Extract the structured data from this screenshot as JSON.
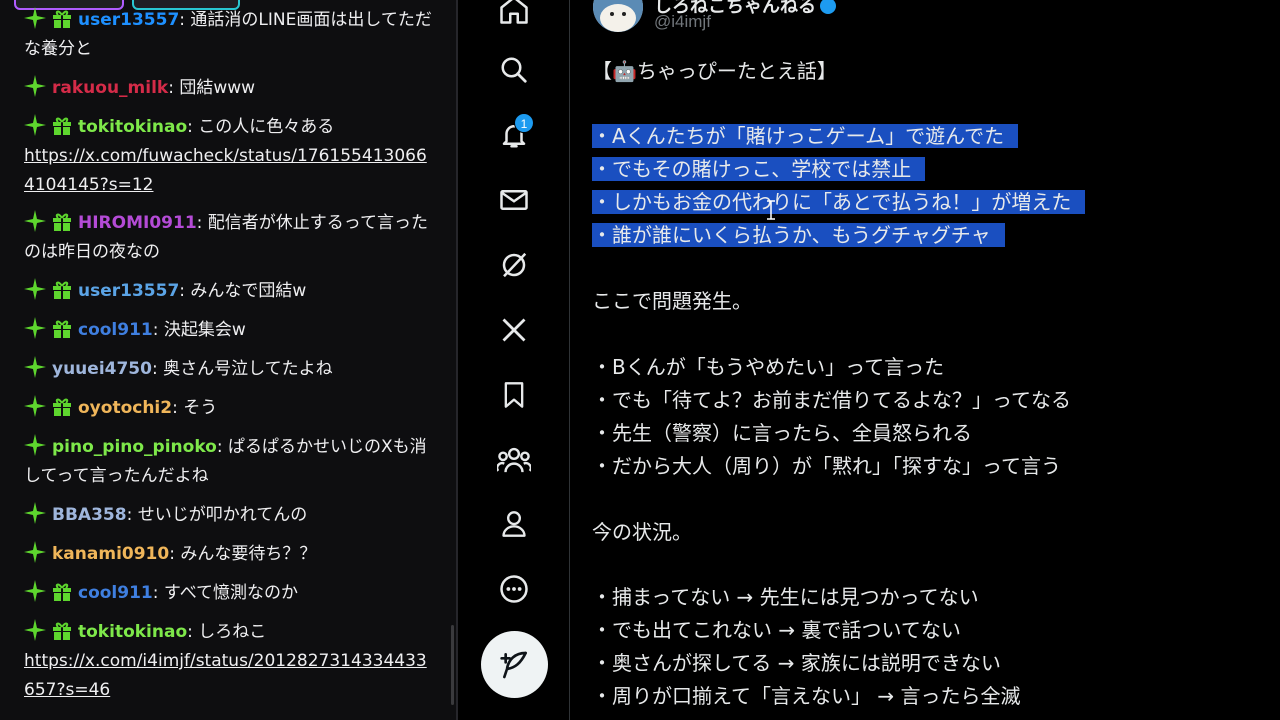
{
  "chat": {
    "messages": [
      {
        "user": "user13557",
        "color": "#1e90ff",
        "gift": true,
        "text": "通話消のLINE画面は出してただな養分と"
      },
      {
        "user": "rakuou_milk",
        "color": "#d42b48",
        "gift": false,
        "text": "団結www"
      },
      {
        "user": "tokitokinao",
        "color": "#7ee84a",
        "gift": true,
        "text": "この人に色々ある",
        "link": "https://x.com/fuwacheck/status/1761554130664104145?s=12"
      },
      {
        "user": "HIROMI0911",
        "color": "#b44bd6",
        "gift": true,
        "text": "配信者が休止するって言ったのは昨日の夜なの"
      },
      {
        "user": "user13557",
        "color": "#5ba4e6",
        "gift": true,
        "text": "みんなで団結w"
      },
      {
        "user": "cool911",
        "color": "#3f7fe0",
        "gift": true,
        "text": "決起集会w"
      },
      {
        "user": "yuuei4750",
        "color": "#9fb6dc",
        "gift": false,
        "text": "奥さん号泣してたよね"
      },
      {
        "user": "oyotochi2",
        "color": "#f0b65a",
        "gift": true,
        "text": "そう"
      },
      {
        "user": "pino_pino_pinoko",
        "color": "#7ee84a",
        "gift": false,
        "text": "ぱるぱるかせいじのXも消してって言ったんだよね"
      },
      {
        "user": "BBA358",
        "color": "#9fb6dc",
        "gift": false,
        "text": "せいじが叩かれてんの"
      },
      {
        "user": "kanami0910",
        "color": "#f0b65a",
        "gift": false,
        "text": "みんな要待ち？？"
      },
      {
        "user": "cool911",
        "color": "#3f7fe0",
        "gift": true,
        "text": "すべて憶測なのか"
      },
      {
        "user": "tokitokinao",
        "color": "#7ee84a",
        "gift": true,
        "text": "しろねこ",
        "link": "https://x.com/i4imjf/status/2012827314334433657?s=46"
      }
    ],
    "separator": ": "
  },
  "nav": {
    "notification_count": "1",
    "icons": [
      "home-icon",
      "search-icon",
      "bell-icon",
      "mail-icon",
      "grok-icon",
      "x-logo-icon",
      "bookmark-icon",
      "communities-icon",
      "profile-icon",
      "more-circle-icon",
      "compose-icon"
    ]
  },
  "post": {
    "display_name": "しろねこちゃんねる",
    "handle": "@i4imjf",
    "title": "【🤖ちゃっぴーたとえ話】",
    "highlighted": [
      "・Aくんたちが「賭けっこゲーム」で遊んでた",
      "・でもその賭けっこ、学校では禁止",
      "・しかもお金の代わりに「あとで払うね！」が増えた",
      "・誰が誰にいくら払うか、もうグチャグチャ"
    ],
    "problem_heading": "ここで問題発生。",
    "problems": [
      "・Bくんが「もうやめたい」って言った",
      "・でも「待てよ？お前まだ借りてるよな？」ってなる",
      "・先生（警察）に言ったら、全員怒られる",
      "・だから大人（周り）が「黙れ」「探すな」って言う"
    ],
    "status_heading": "今の状況。",
    "status": [
      "・捕まってない → 先生には見つかってない",
      "・でも出てこれない → 裏で話ついてない",
      "・奥さんが探してる → 家族には説明できない",
      "・周りが口揃えて「言えない」 → 言ったら全滅"
    ]
  },
  "colors": {
    "accent": "#1d9bf0",
    "highlight": "#1a4fc0",
    "badge_green": "#5ed62e"
  }
}
